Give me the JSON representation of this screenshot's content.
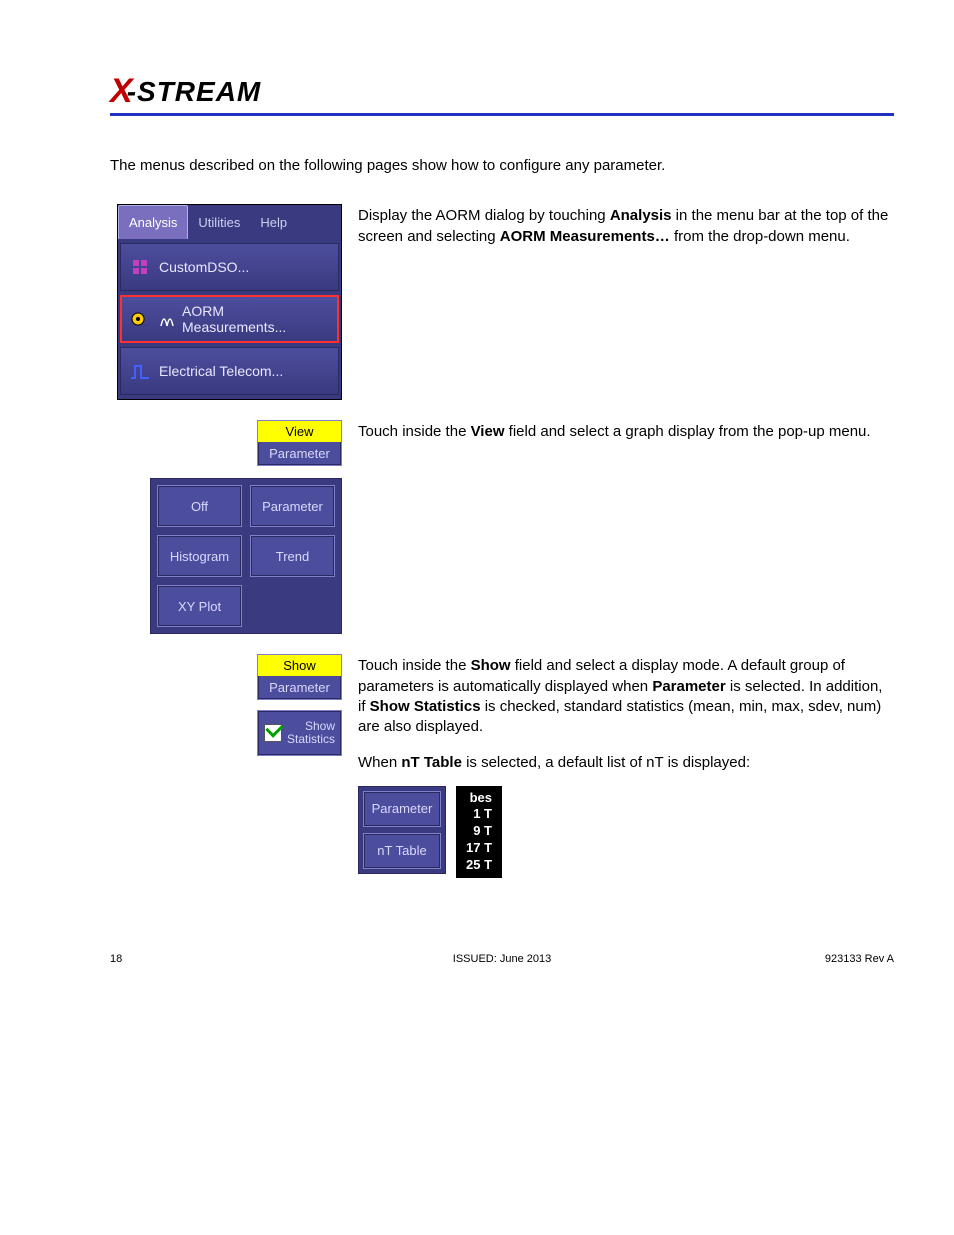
{
  "logo": {
    "x": "X",
    "rest": "-STREAM"
  },
  "intro": "The menus described on the following pages show how to configure any parameter.",
  "section1": {
    "text_a": "Display the AORM dialog by touching ",
    "bold_a": "Analysis",
    "text_b": " in the menu bar at the top of the screen and selecting ",
    "bold_b": "AORM Measurements…",
    "text_c": " from the drop-down menu.",
    "tabs": {
      "analysis": "Analysis",
      "utilities": "Utilities",
      "help": "Help"
    },
    "items": {
      "customdso": "CustomDSO...",
      "aorm": "AORM Measurements...",
      "telecom": "Electrical Telecom..."
    }
  },
  "section2": {
    "text_a": "Touch inside the ",
    "bold_a": "View",
    "text_b": " field and select a graph display from the pop-up menu.",
    "view_btn": {
      "hdr": "View",
      "body": "Parameter"
    },
    "options": {
      "off": "Off",
      "parameter": "Parameter",
      "histogram": "Histogram",
      "trend": "Trend",
      "xyplot": "XY Plot"
    }
  },
  "section3": {
    "text_a": "Touch inside the ",
    "bold_a": "Show",
    "text_b": " field and select a display mode. A default group of parameters is automatically displayed when ",
    "bold_b": "Parameter",
    "text_c": " is selected. In addition, if ",
    "bold_c": "Show Statistics",
    "text_d": " is checked, standard statistics (mean, min, max, sdev, num) are also displayed.",
    "text_e": "When ",
    "bold_e": "nT Table",
    "text_f": " is selected, a default list of nT is displayed:",
    "show_btn": {
      "hdr": "Show",
      "body": "Parameter"
    },
    "stats_btn": {
      "line1": "Show",
      "line2": "Statistics"
    },
    "nt_options": {
      "parameter": "Parameter",
      "nttable": "nT Table"
    },
    "nt_values": {
      "hdr": "bes",
      "r1": "1 T",
      "r2": "9 T",
      "r3": "17 T",
      "r4": "25 T"
    }
  },
  "footer": {
    "page": "18",
    "issued": "ISSUED: June 2013",
    "rev": "923133 Rev A"
  }
}
